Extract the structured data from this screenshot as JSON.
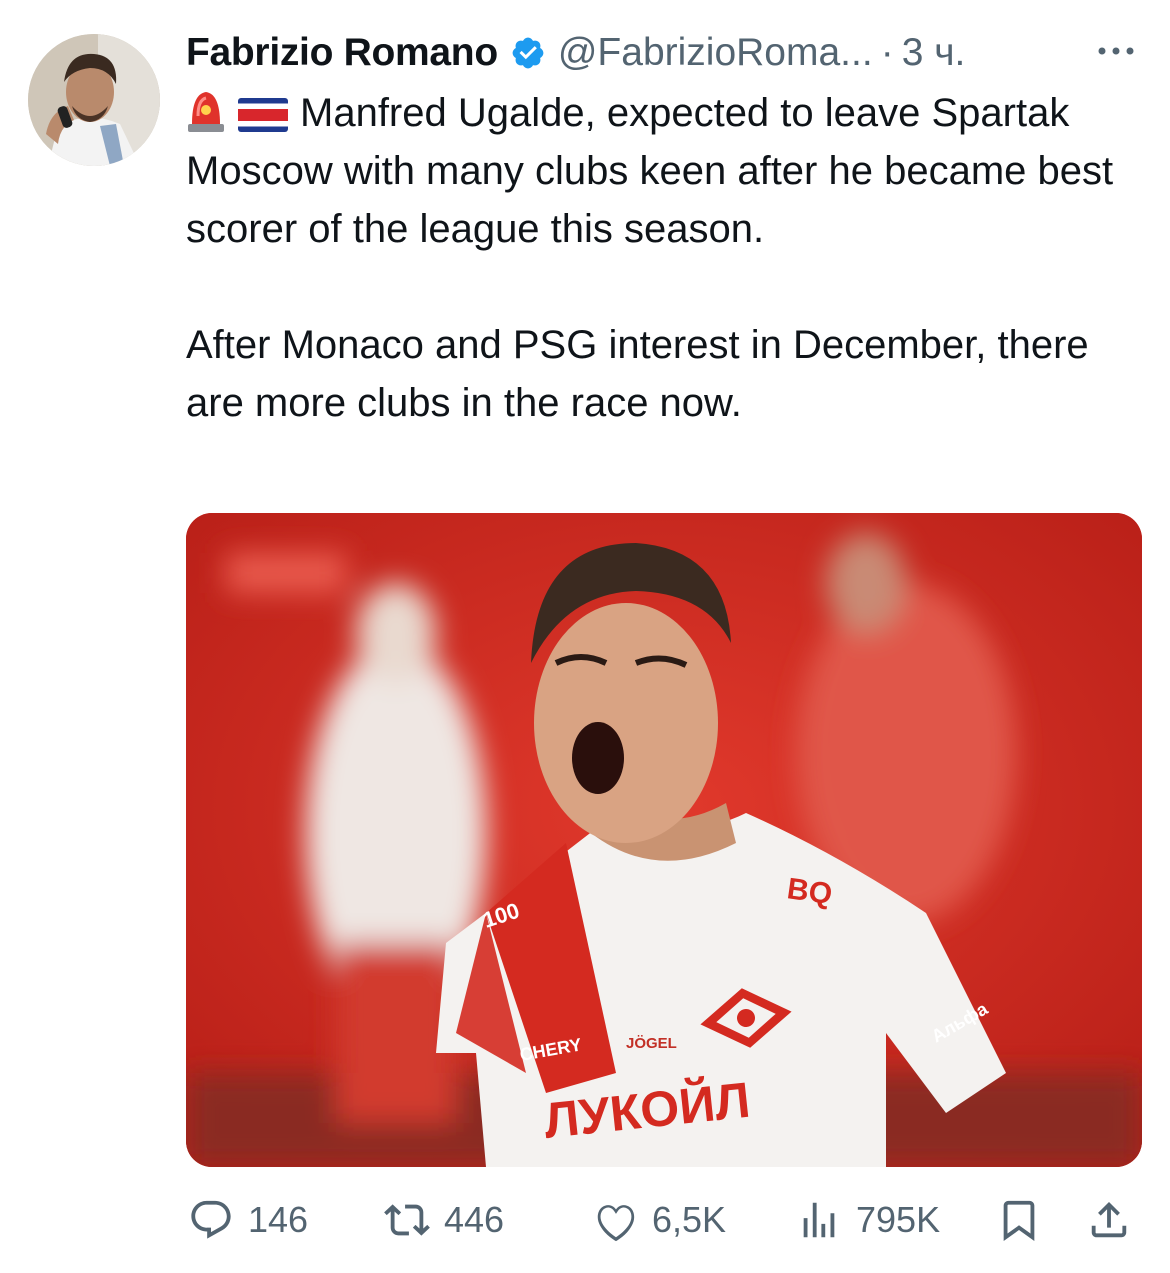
{
  "author": {
    "name": "Fabrizio Romano",
    "handle": "@FabrizioRoma...",
    "separator": "·",
    "time": "3 ч.",
    "verified_icon": "verified-badge-icon",
    "accent": "#1d9bf0"
  },
  "tweet": {
    "line1": "Manfred Ugalde, expected to leave Spartak Moscow with many clubs keen after he became best scorer of the league this season.",
    "line2": "After Monaco and PSG interest in December, there are more clubs in the race now.",
    "emojis": [
      "siren-emoji",
      "costa-rica-flag-emoji"
    ]
  },
  "media": {
    "shirt_text_main": "ЛУКОЙЛ",
    "shirt_sponsor": "CHERY",
    "shirt_maker": "JÖGEL",
    "shirt_badge": "BQ",
    "shirt_sleeve": "Альфа",
    "shirt_collar": "100",
    "club_color": "#d7281e"
  },
  "actions": {
    "replies": "146",
    "retweets": "446",
    "likes": "6,5K",
    "views": "795K"
  }
}
